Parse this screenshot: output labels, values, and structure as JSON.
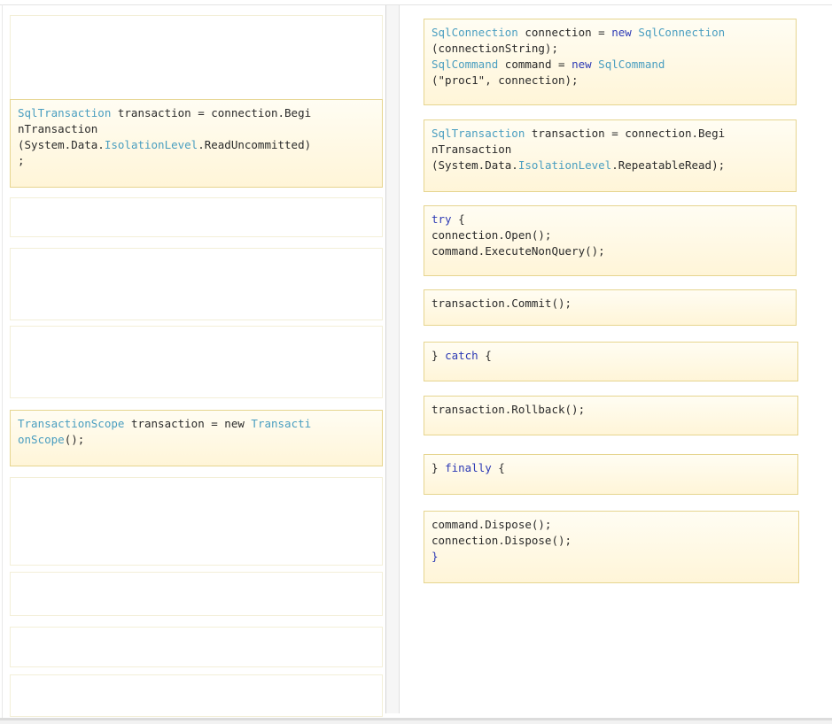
{
  "colors": {
    "type": "#4a9ec0",
    "keyword": "#2d3ab5",
    "text": "#2a2a2a",
    "block_border": "#e6d58f",
    "block_fill": "#fff5d8"
  },
  "source_blocks": [
    {
      "line1_type": "SqlTransaction",
      "line1_rest": " transaction = connection.Begi",
      "line2": "nTransaction",
      "line3_pre": "(System.Data.",
      "line3_type": "IsolationLevel",
      "line3_post": ".ReadUncommitted)",
      "line4": ";"
    },
    {
      "line1_type": "TransactionScope",
      "line1_rest": " transaction = new ",
      "line1_type2": "Transacti",
      "line2_type": "onScope",
      "line2_rest": "();"
    }
  ],
  "answer_blocks": {
    "connection": {
      "l1_type": "SqlConnection",
      "l1_mid": " connection = ",
      "l1_kw": "new",
      "l1_sp": " ",
      "l1_type2": "SqlConnection",
      "l2": "(connectionString);",
      "l3_type": "SqlCommand",
      "l3_mid": " command = ",
      "l3_kw": "new",
      "l3_sp": " ",
      "l3_type2": "SqlCommand",
      "l4": "(\"proc1\", connection);"
    },
    "transaction": {
      "l1_type": "SqlTransaction",
      "l1_rest": " transaction = connection.Begi",
      "l2": "nTransaction",
      "l3_pre": "(System.Data.",
      "l3_type": "IsolationLevel",
      "l3_post": ".RepeatableRead);"
    },
    "try_open": {
      "l1_kw": "try",
      "l1_rest": " {",
      "l2": "connection.Open();",
      "l3": "command.ExecuteNonQuery();"
    },
    "commit": {
      "l1": "transaction.Commit();"
    },
    "catch": {
      "l1_pre": "} ",
      "l1_kw": "catch",
      "l1_post": " {"
    },
    "rollback": {
      "l1": "transaction.Rollback();"
    },
    "finally": {
      "l1_pre": "} ",
      "l1_kw": "finally",
      "l1_post": " {"
    },
    "dispose": {
      "l1": "command.Dispose();",
      "l2": "connection.Dispose();",
      "l3": "}"
    }
  }
}
